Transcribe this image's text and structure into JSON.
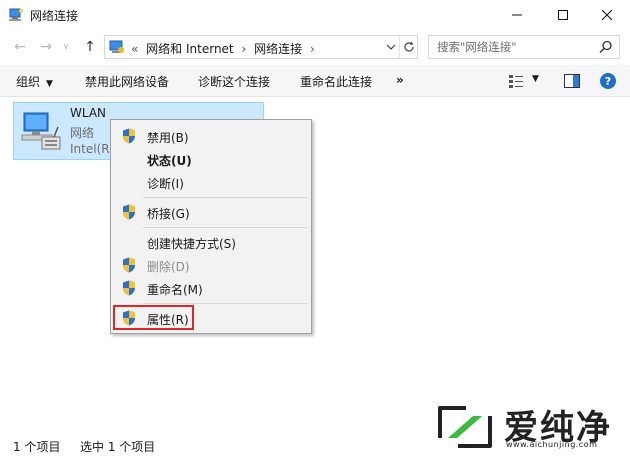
{
  "window": {
    "title": "网络连接",
    "icon": "network-connections-icon",
    "controls": [
      "minimize-icon",
      "maximize-icon",
      "close-icon"
    ]
  },
  "navigation": {
    "breadcrumb_prefix": "«",
    "breadcrumb": [
      "网络和 Internet",
      "网络连接"
    ],
    "search_placeholder": "搜索\"网络连接\""
  },
  "commands": {
    "organize": "组织",
    "disable_device": "禁用此网络设备",
    "diagnose": "诊断这个连接",
    "rename": "重命名此连接",
    "more": "»"
  },
  "connection": {
    "name": "WLAN",
    "status": "网络",
    "device": "Intel(R)"
  },
  "context_menu": {
    "items": [
      {
        "label": "禁用(B)",
        "shield": true,
        "bold": false,
        "disabled": false
      },
      {
        "label": "状态(U)",
        "shield": false,
        "bold": true,
        "disabled": false
      },
      {
        "label": "诊断(I)",
        "shield": false,
        "bold": false,
        "disabled": false
      },
      {
        "label": "桥接(G)",
        "shield": true,
        "bold": false,
        "disabled": false
      },
      {
        "label": "创建快捷方式(S)",
        "shield": false,
        "bold": false,
        "disabled": false
      },
      {
        "label": "删除(D)",
        "shield": true,
        "bold": false,
        "disabled": true
      },
      {
        "label": "重命名(M)",
        "shield": true,
        "bold": false,
        "disabled": false
      },
      {
        "label": "属性(R)",
        "shield": true,
        "bold": false,
        "disabled": false
      }
    ]
  },
  "status_bar": {
    "item_count": "1 个项目",
    "selected": "选中 1 个项目"
  },
  "watermark": {
    "text": "爱纯净",
    "url": "www.aichunjing.com"
  },
  "colors": {
    "selection_fill": "#cce8ff",
    "selection_border": "#99d1ff",
    "highlight_box": "#e0262b",
    "help_blue": "#1e6fc9"
  }
}
